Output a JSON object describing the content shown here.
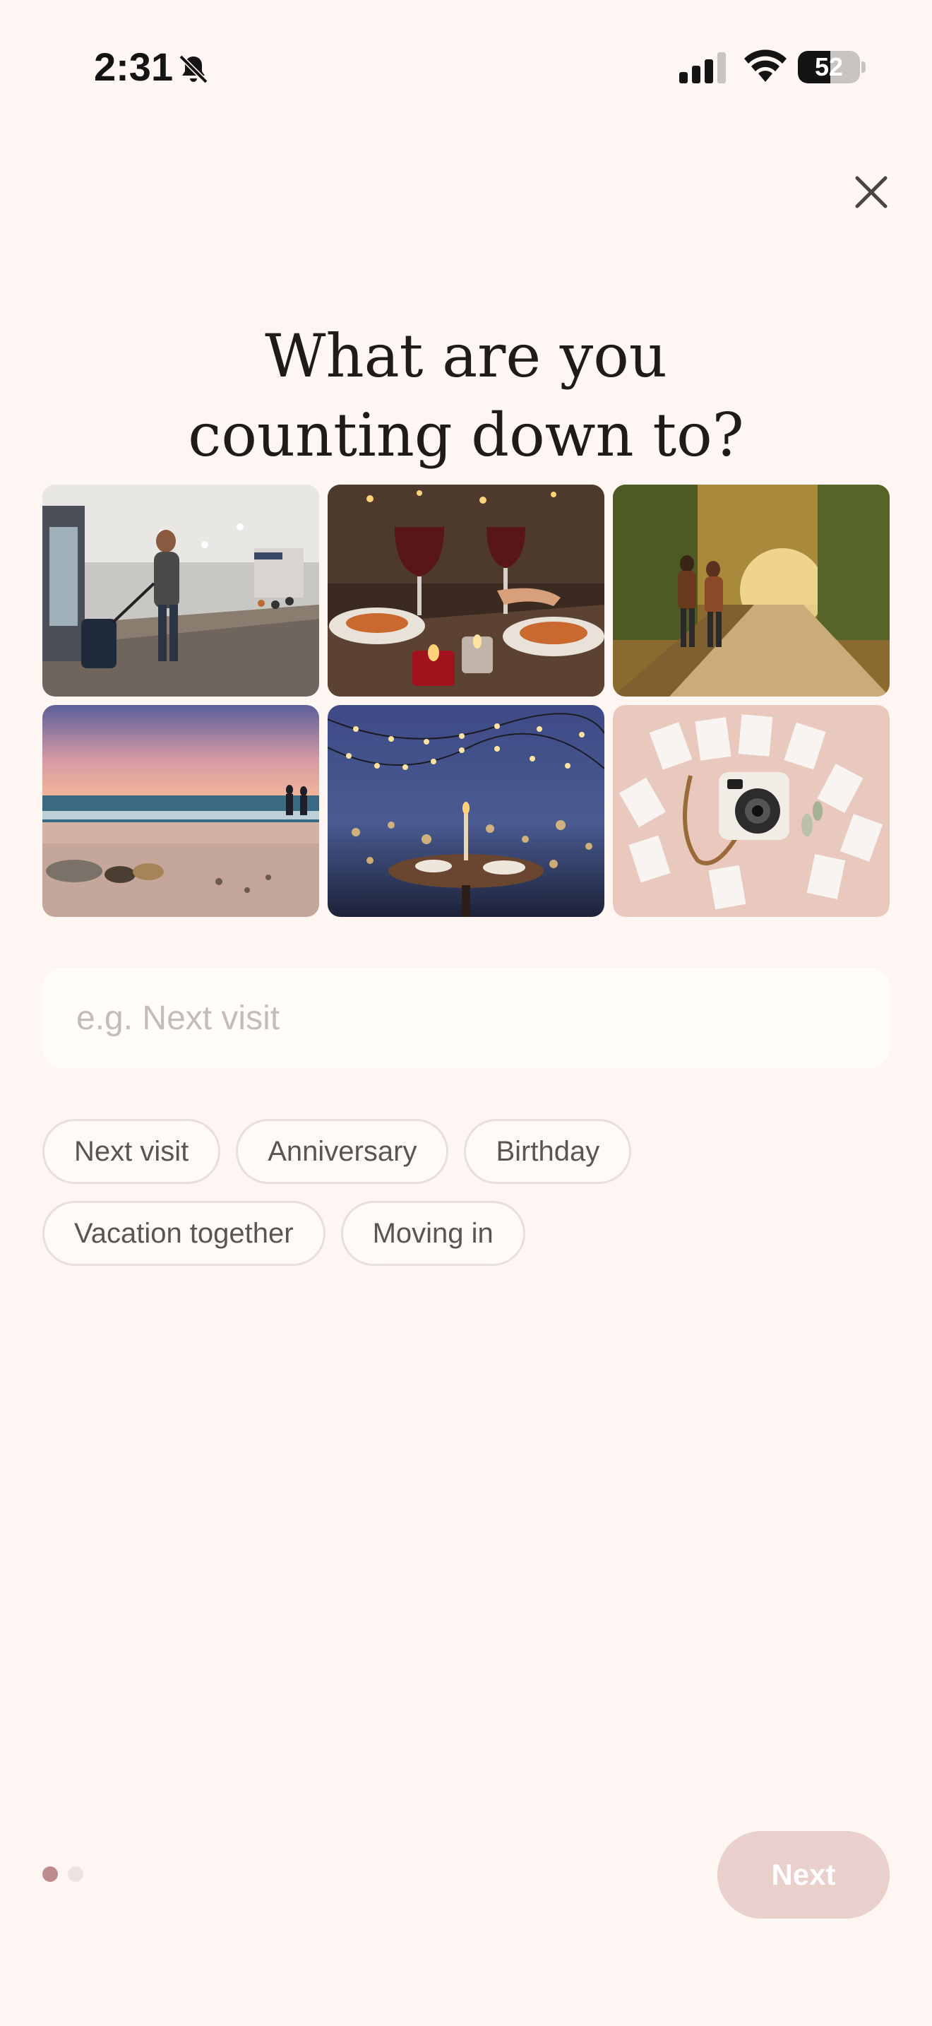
{
  "status_bar": {
    "time": "2:31",
    "battery_level": "52",
    "battery_fraction": 0.52,
    "icons": [
      "bell-muted-icon",
      "cellular-signal-icon",
      "wifi-icon",
      "battery-icon"
    ]
  },
  "header": {
    "close_icon": "close-icon",
    "title_line1": "What are you",
    "title_line2": "counting down to?"
  },
  "photo_grid": {
    "tiles": [
      {
        "subject": "traveler-airport"
      },
      {
        "subject": "candlelit-dinner"
      },
      {
        "subject": "couple-autumn-walk"
      },
      {
        "subject": "beach-sunset"
      },
      {
        "subject": "rooftop-string-lights"
      },
      {
        "subject": "instant-camera-photos"
      }
    ]
  },
  "search": {
    "placeholder": "e.g. Next visit",
    "value": ""
  },
  "suggestions": {
    "row1": [
      "Next visit",
      "Anniversary",
      "Birthday"
    ],
    "row2": [
      "Vacation together",
      "Moving in"
    ]
  },
  "footer": {
    "page_index": 1,
    "page_count": 2,
    "next_label": "Next"
  },
  "colors": {
    "background": "#fdf6f2",
    "accent_dot": "#c08b8f",
    "next_button_disabled": "#ead0cd",
    "chip_border": "#e8dfda"
  }
}
